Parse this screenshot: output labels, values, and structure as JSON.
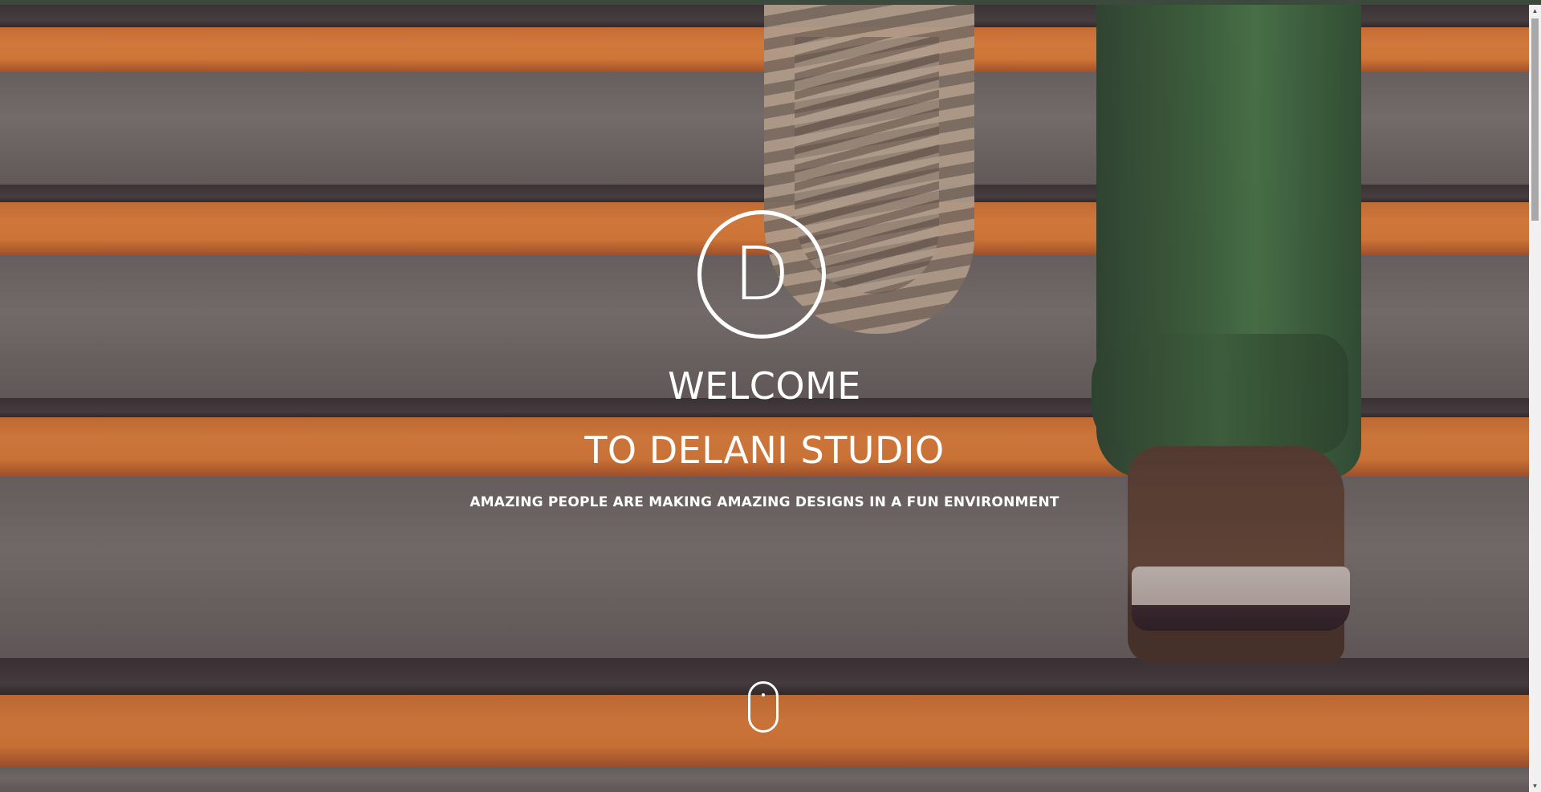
{
  "hero": {
    "logo_letter": "D",
    "title_line1": "WELCOME",
    "title_line2": "TO DELANI STUDIO",
    "tagline": "AMAZING PEOPLE ARE MAKING AMAZING DESIGNS IN A FUN ENVIRONMENT"
  },
  "icons": {
    "scroll_indicator": "mouse-scroll-icon",
    "scroll_up": "chevron-up-icon",
    "scroll_down": "chevron-down-icon"
  },
  "colors": {
    "text": "#ffffff",
    "stair_orange": "#f28a3c",
    "stair_stone": "#7a746f",
    "pants_green": "#3d6a3c"
  }
}
